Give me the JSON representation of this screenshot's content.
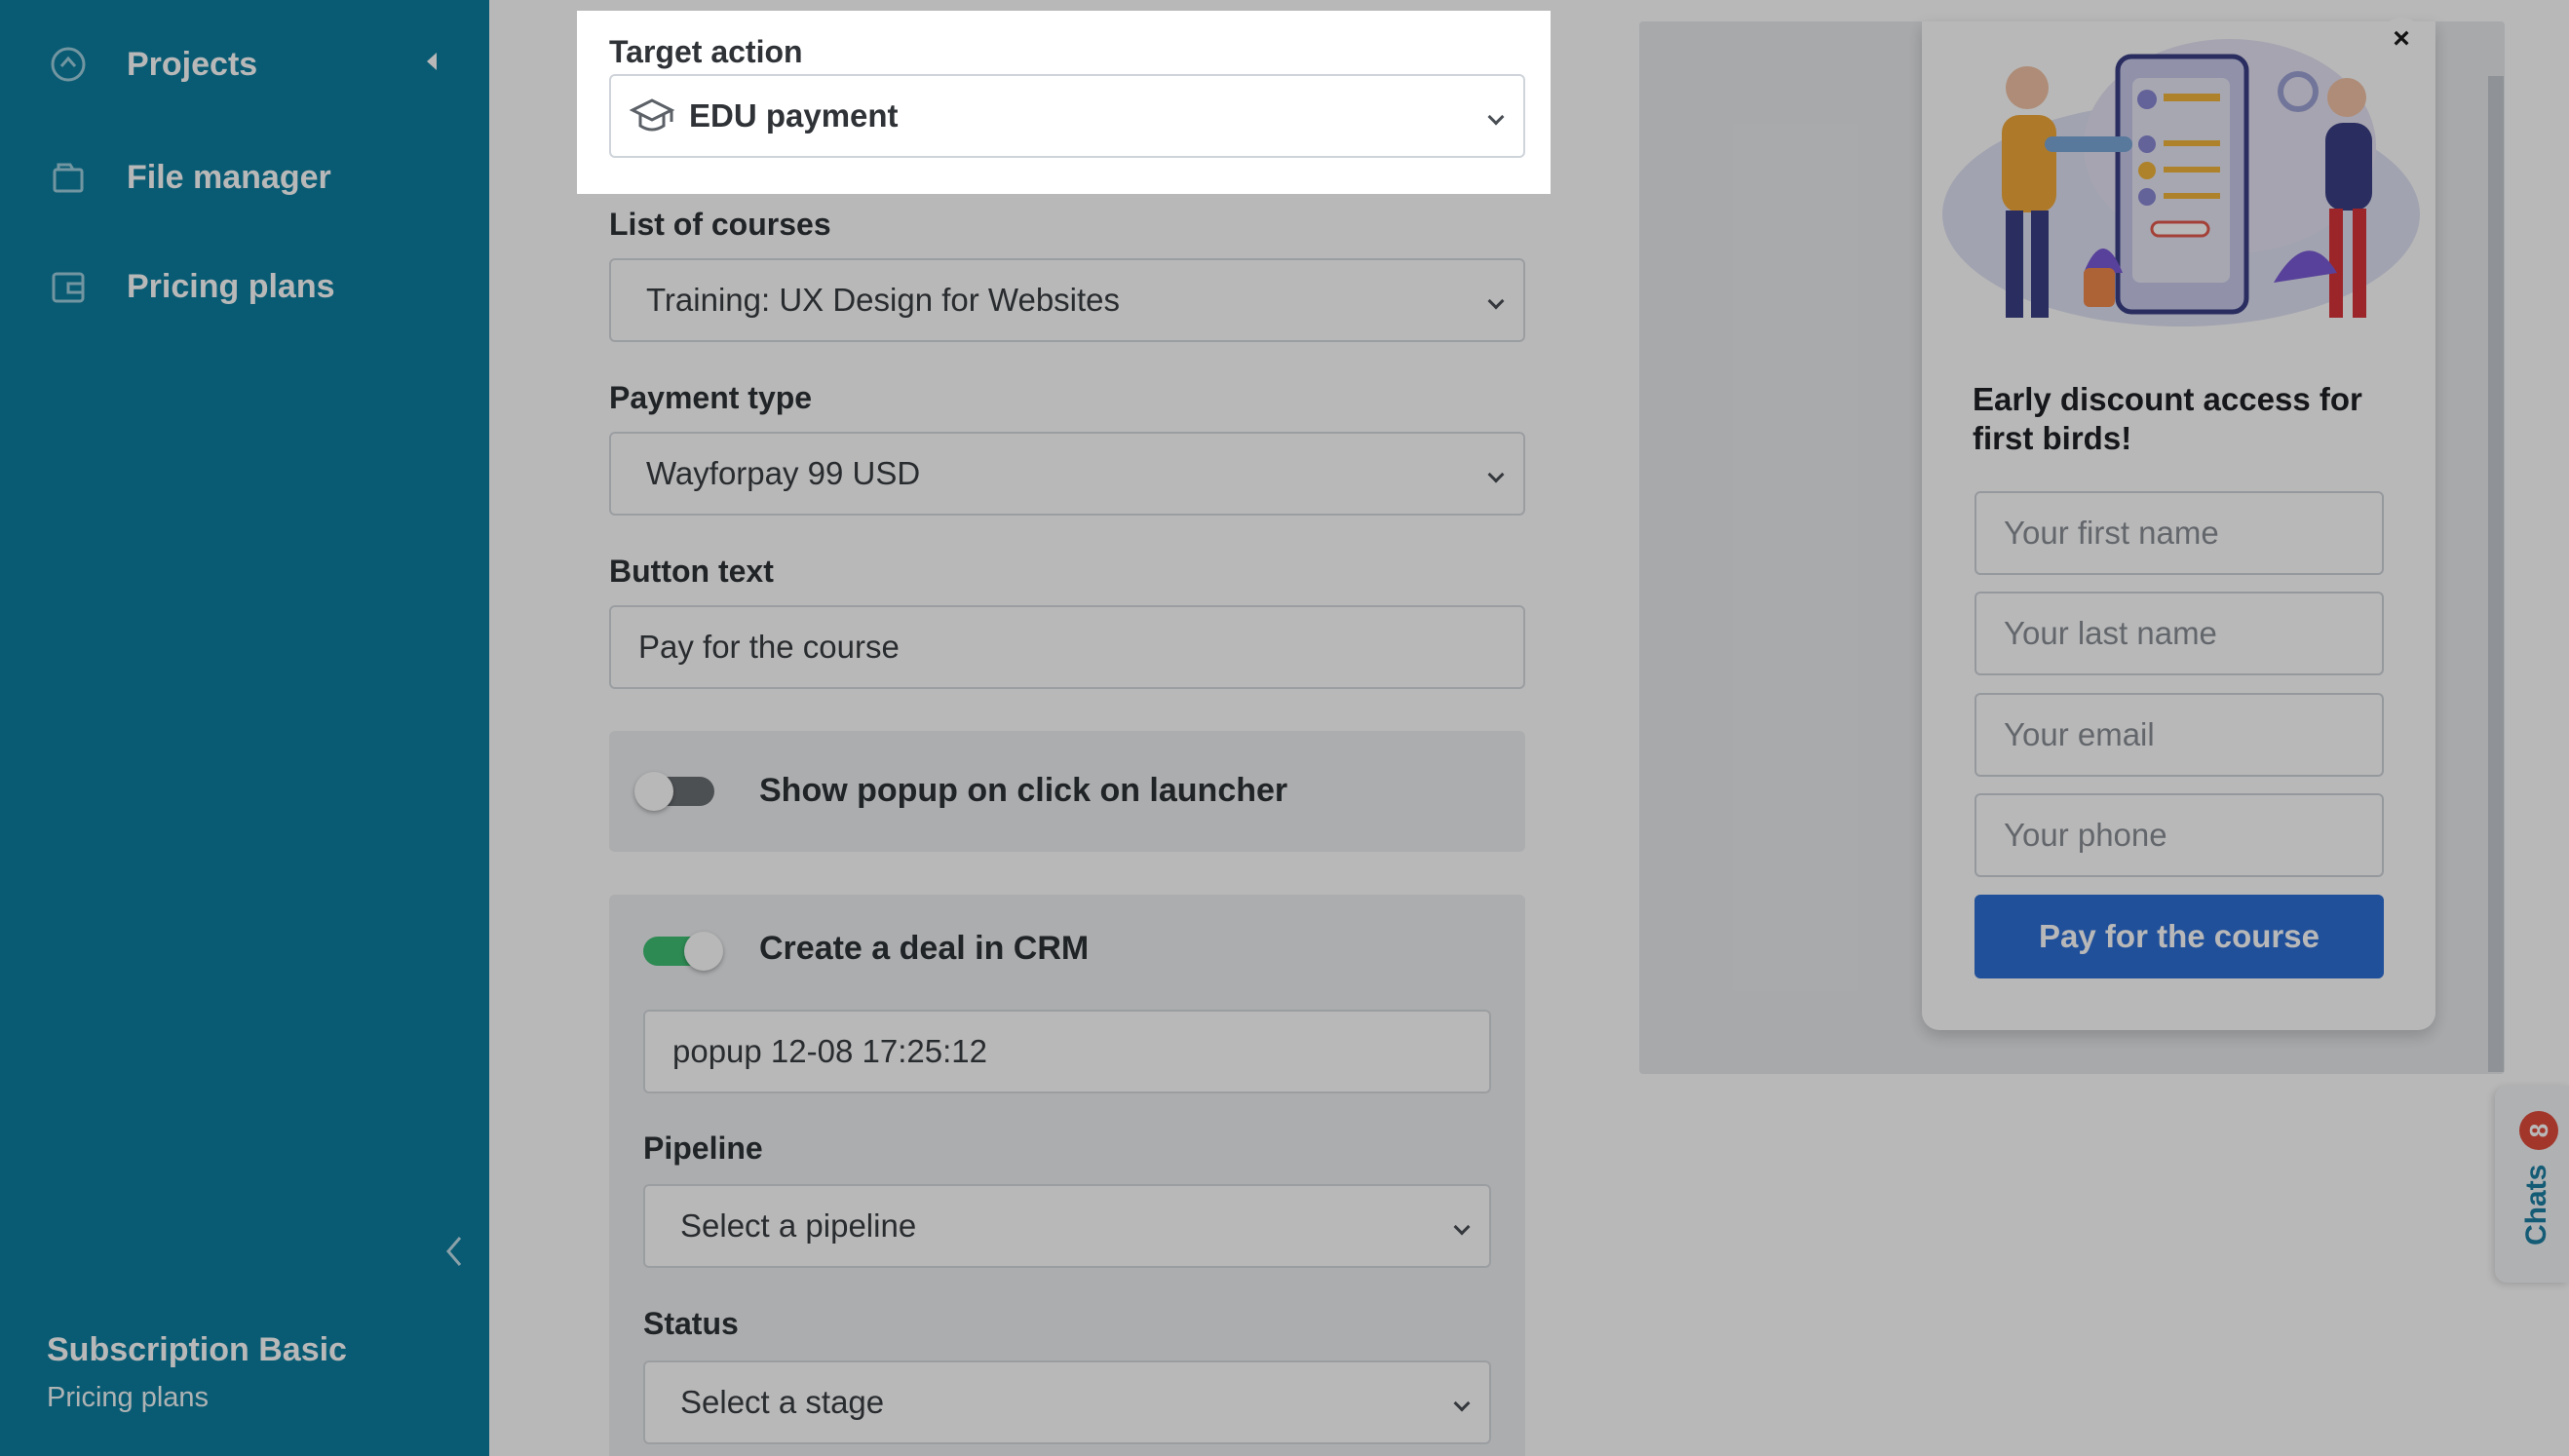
{
  "sidebar": {
    "items": [
      {
        "label": "Projects",
        "icon": "projects-icon"
      },
      {
        "label": "File manager",
        "icon": "folder-icon"
      },
      {
        "label": "Pricing plans",
        "icon": "wallet-icon"
      }
    ],
    "plan": {
      "name": "Subscription Basic",
      "sub": "Pricing plans"
    }
  },
  "form": {
    "target_action": {
      "label": "Target action",
      "value": "EDU payment",
      "icon": "graduation-cap-icon"
    },
    "courses": {
      "label": "List of courses",
      "value": "Training: UX Design for Websites"
    },
    "payment_type": {
      "label": "Payment type",
      "value": "Wayforpay 99 USD"
    },
    "button_text": {
      "label": "Button text",
      "value": "Pay for the course"
    },
    "popup_toggle": {
      "label": "Show popup on click on launcher",
      "on": false
    },
    "crm_toggle": {
      "label": "Create a deal in CRM",
      "on": true
    },
    "deal_name": {
      "value": "popup 12-08 17:25:12"
    },
    "pipeline": {
      "label": "Pipeline",
      "value": "Select a pipeline"
    },
    "status": {
      "label": "Status",
      "value": "Select a stage"
    }
  },
  "popup": {
    "title": "Early discount access for first birds!",
    "fields": [
      "Your first name",
      "Your last name",
      "Your email",
      "Your phone"
    ],
    "button": "Pay for the course",
    "close": "×"
  },
  "chats": {
    "label": "Chats",
    "badge": "8"
  },
  "colors": {
    "sidebar": "#0d7ea0",
    "primary_button": "#2f6fd6",
    "toggle_on": "#3fbf73",
    "badge": "#e14b3b"
  }
}
